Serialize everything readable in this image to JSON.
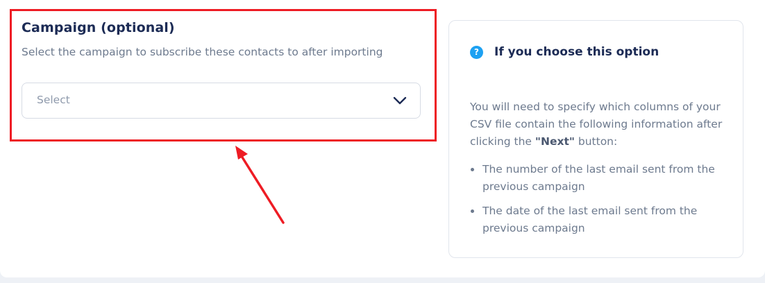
{
  "campaign_field": {
    "title": "Campaign (optional)",
    "description": "Select the campaign to subscribe these contacts to after importing",
    "select_placeholder": "Select"
  },
  "info_panel": {
    "icon": "question-icon",
    "icon_glyph": "?",
    "title": "If you choose this option",
    "body_before": "You will need to specify which columns of your CSV file contain the following information after clicking the ",
    "body_bold": "\"Next\"",
    "body_after": " button:",
    "items": [
      "The number of the last email sent from the previous campaign",
      "The date of the last email sent from the previous campaign"
    ]
  },
  "colors": {
    "highlight": "#ee1c24",
    "accent": "#1da1f2",
    "title": "#1c2b55",
    "muted_text": "#6d7a8e"
  }
}
